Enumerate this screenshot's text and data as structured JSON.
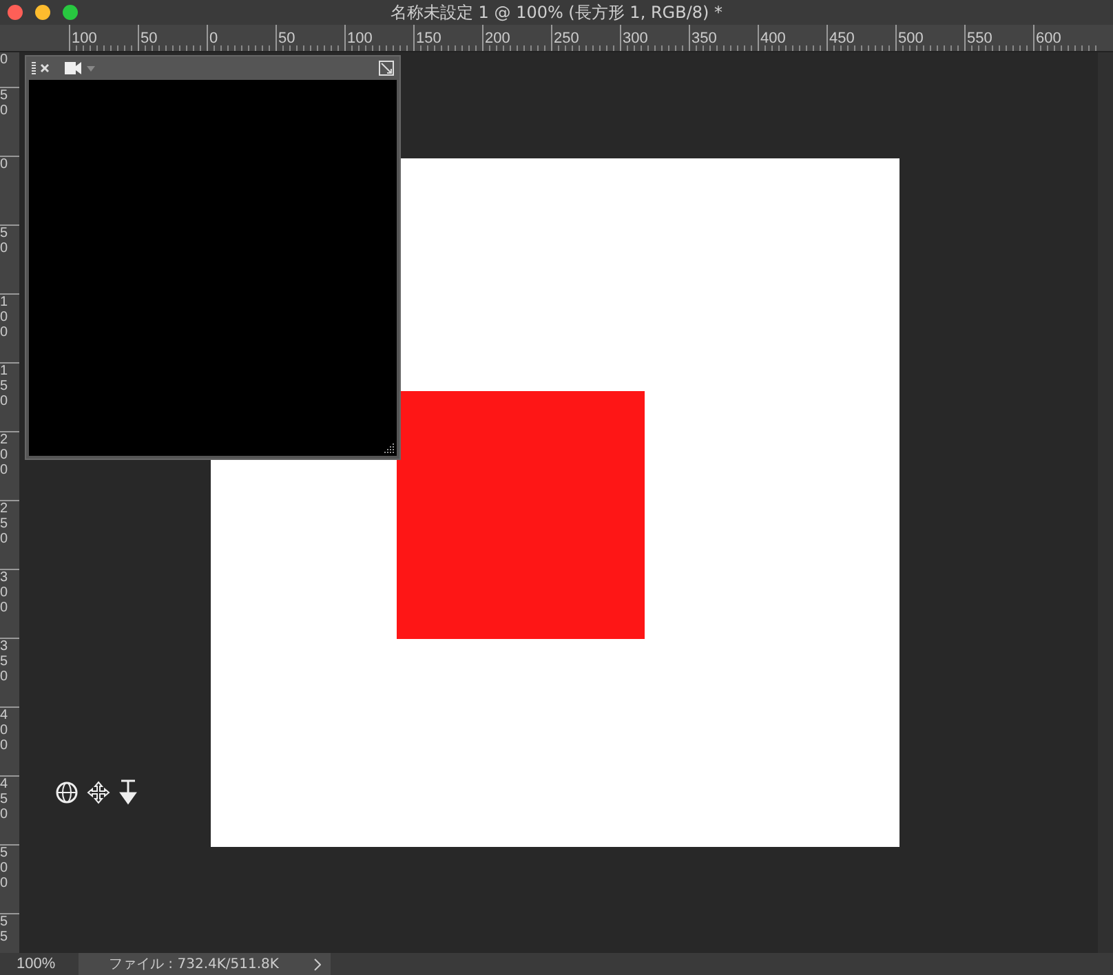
{
  "window": {
    "title": "名称未設定 1 @ 100% (長方形 1, RGB/8) *"
  },
  "horizontal_ruler": {
    "labels": [
      "100",
      "50",
      "0",
      "50",
      "100",
      "150",
      "200",
      "250",
      "300",
      "350",
      "400",
      "450",
      "500",
      "550",
      "600"
    ]
  },
  "vertical_ruler": {
    "labels": [
      "0",
      "50",
      "0",
      "50",
      "100",
      "150",
      "200",
      "250",
      "300",
      "350",
      "400",
      "450",
      "500",
      "55"
    ]
  },
  "status_bar": {
    "zoom": "100%",
    "file_info": "ファイル : 732.4K/511.8K"
  }
}
